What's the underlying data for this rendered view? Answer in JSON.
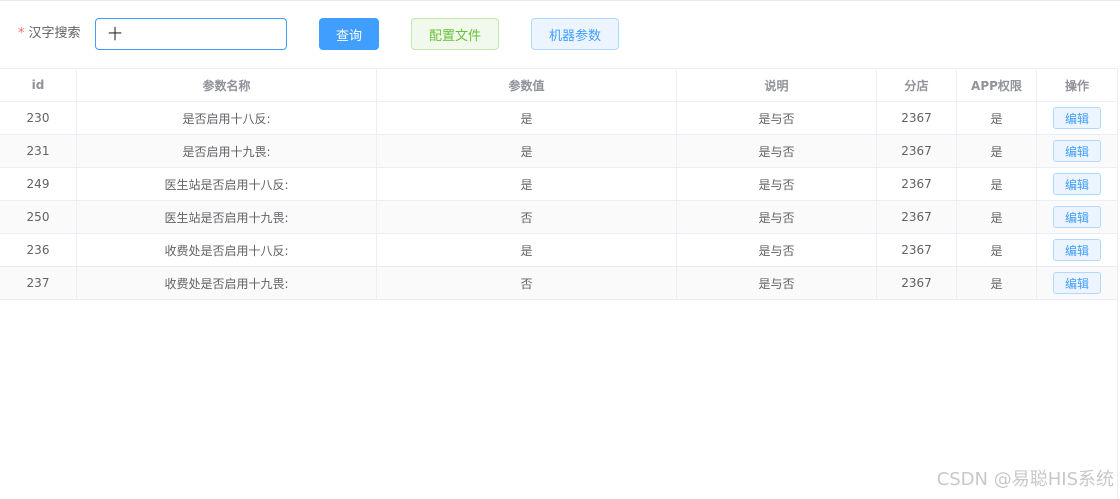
{
  "search": {
    "required_mark": "*",
    "label": "汉字搜索",
    "value": "十"
  },
  "buttons": {
    "query": "查询",
    "config": "配置文件",
    "machine": "机器参数"
  },
  "table": {
    "headers": [
      "id",
      "参数名称",
      "参数值",
      "说明",
      "分店",
      "APP权限",
      "操作"
    ],
    "edit_label": "编辑",
    "rows": [
      {
        "id": "230",
        "name": "是否启用十八反:",
        "value": "是",
        "desc": "是与否",
        "store": "2367",
        "app": "是"
      },
      {
        "id": "231",
        "name": "是否启用十九畏:",
        "value": "是",
        "desc": "是与否",
        "store": "2367",
        "app": "是"
      },
      {
        "id": "249",
        "name": "医生站是否启用十八反:",
        "value": "是",
        "desc": "是与否",
        "store": "2367",
        "app": "是"
      },
      {
        "id": "250",
        "name": "医生站是否启用十九畏:",
        "value": "否",
        "desc": "是与否",
        "store": "2367",
        "app": "是"
      },
      {
        "id": "236",
        "name": "收费处是否启用十八反:",
        "value": "是",
        "desc": "是与否",
        "store": "2367",
        "app": "是"
      },
      {
        "id": "237",
        "name": "收费处是否启用十九畏:",
        "value": "否",
        "desc": "是与否",
        "store": "2367",
        "app": "是"
      }
    ]
  },
  "watermark": "CSDN @易聪HIS系统",
  "colors": {
    "primary": "#409eff",
    "success": "#67c23a",
    "danger": "#f56c6c",
    "border": "#ebeef5"
  }
}
